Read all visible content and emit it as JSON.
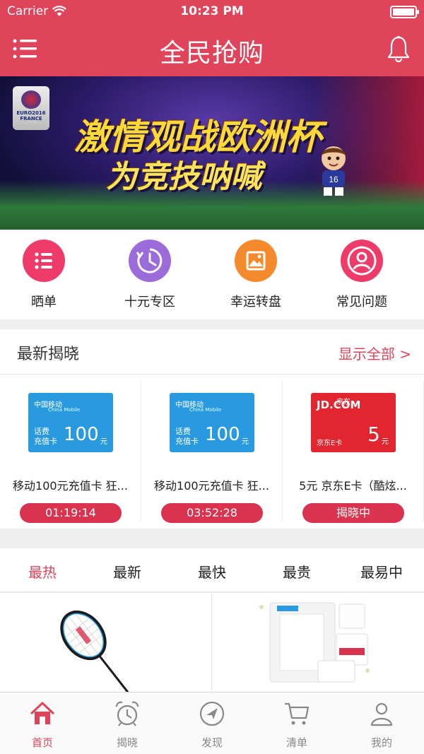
{
  "status_bar": {
    "carrier": "Carrier",
    "time": "10:23 PM",
    "battery_level": 1.0
  },
  "header": {
    "title": "全民抢购",
    "menu_icon": "menu-icon",
    "bell_icon": "bell-icon"
  },
  "banner": {
    "logo_text": "EURO2016 FRANCE",
    "line1": "激情观战欧洲杯",
    "line2": "为竞技呐喊",
    "slides": 3,
    "active_slide": 0
  },
  "quick_links": [
    {
      "label": "晒单",
      "icon": "list-icon",
      "color": "#ee3b6a"
    },
    {
      "label": "十元专区",
      "icon": "clock-icon",
      "color": "#9b6bd9"
    },
    {
      "label": "幸运转盘",
      "icon": "image-icon",
      "color": "#f58a2c"
    },
    {
      "label": "常见问题",
      "icon": "user-icon",
      "color": "#ee3b6a"
    }
  ],
  "latest": {
    "title": "最新揭晓",
    "show_all": "显示全部 >",
    "items": [
      {
        "title": "移动100元充值卡 狂...",
        "card_brand": "中国移动",
        "card_brand_en": "China Mobile",
        "card_line1": "话费",
        "card_line2": "充值卡",
        "card_value": "100",
        "card_unit": "元",
        "status": "01:19:14",
        "card_color": "#2a9ae0"
      },
      {
        "title": "移动100元充值卡 狂...",
        "card_brand": "中国移动",
        "card_brand_en": "China Mobile",
        "card_line1": "话费",
        "card_line2": "充值卡",
        "card_value": "100",
        "card_unit": "元",
        "status": "03:52:28",
        "card_color": "#2a9ae0"
      },
      {
        "title": "5元 京东E卡（酷炫...",
        "card_brand": "JD.COM",
        "card_brand_en": "京东",
        "card_line1": "京东E卡",
        "card_line2": "",
        "card_value": "5",
        "card_unit": "元",
        "status": "揭晓中",
        "card_color": "#e2262f"
      }
    ]
  },
  "tabs": [
    {
      "label": "最热",
      "active": true
    },
    {
      "label": "最新",
      "active": false
    },
    {
      "label": "最快",
      "active": false
    },
    {
      "label": "最贵",
      "active": false
    },
    {
      "label": "最易中",
      "active": false
    }
  ],
  "products": [
    {
      "image": "badminton-racket-image"
    },
    {
      "image": "tissue-pack-image"
    }
  ],
  "bottom_nav": [
    {
      "label": "首页",
      "icon": "home-icon",
      "active": true
    },
    {
      "label": "揭晓",
      "icon": "alarm-clock-icon",
      "active": false
    },
    {
      "label": "发现",
      "icon": "compass-icon",
      "active": false
    },
    {
      "label": "清单",
      "icon": "cart-icon",
      "active": false
    },
    {
      "label": "我的",
      "icon": "person-icon",
      "active": false
    }
  ],
  "colors": {
    "brand": "#e0445a",
    "pill": "#d9334f",
    "inactive": "#888888"
  }
}
